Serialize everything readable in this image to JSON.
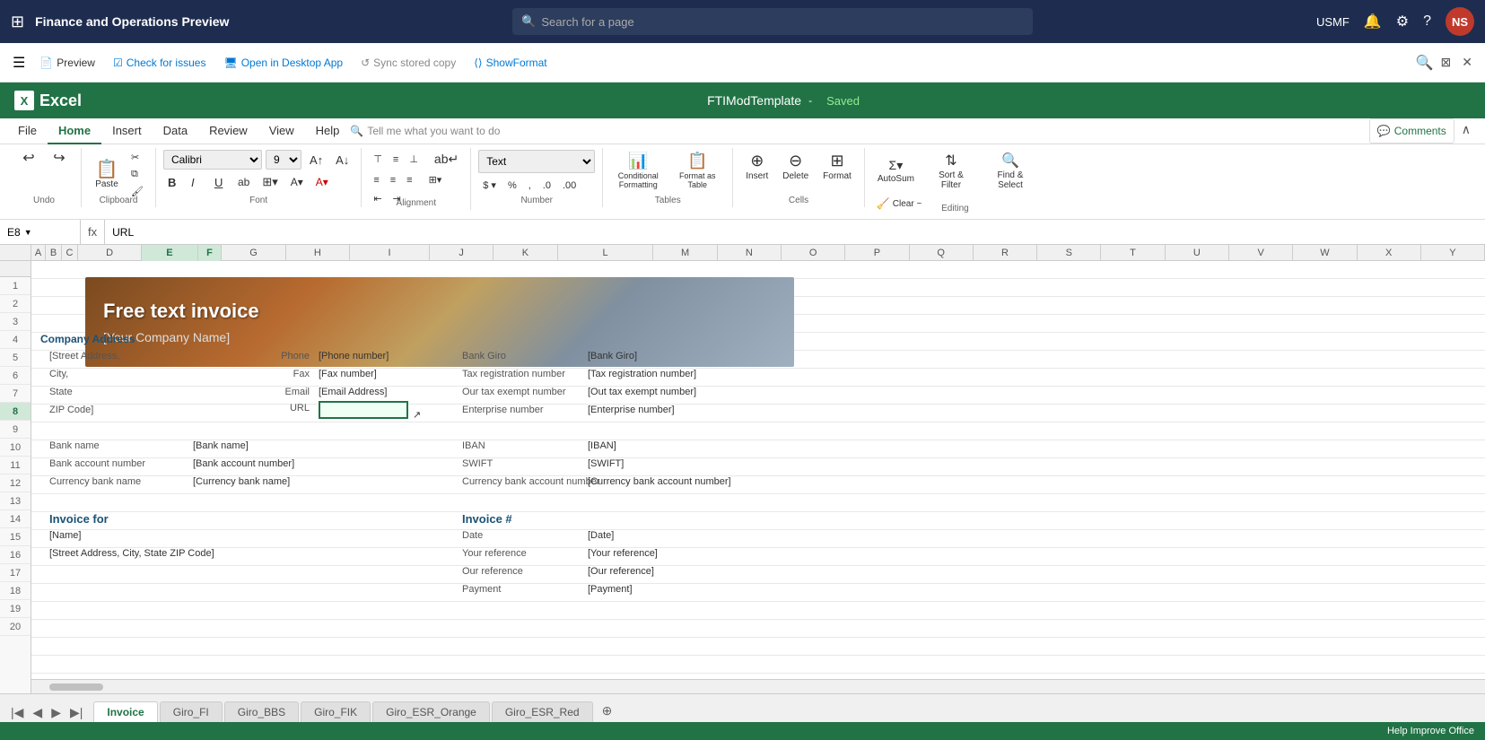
{
  "topNav": {
    "appTitle": "Finance and Operations Preview",
    "searchPlaceholder": "Search for a page",
    "userCode": "USMF",
    "userInitials": "NS"
  },
  "d365Toolbar": {
    "previewLabel": "Preview",
    "checkIssuesLabel": "Check for issues",
    "openDesktopLabel": "Open in Desktop App",
    "syncLabel": "Sync stored copy",
    "showFormatLabel": "ShowFormat"
  },
  "excel": {
    "appName": "Excel",
    "docTitle": "FTIModTemplate",
    "savedLabel": "Saved"
  },
  "ribbon": {
    "tabs": [
      "File",
      "Home",
      "Insert",
      "Data",
      "Review",
      "View",
      "Help"
    ],
    "activeTab": "Home",
    "tellMe": "Tell me what you want to do",
    "commentsLabel": "Comments",
    "groups": {
      "undo": "Undo",
      "clipboard": "Clipboard",
      "font": "Font",
      "alignment": "Alignment",
      "number": "Number",
      "tables": "Tables",
      "cells": "Cells",
      "editing": "Editing"
    },
    "fontName": "Calibri",
    "fontSize": "9",
    "numberFormat": "Text",
    "pasteLabel": "Paste",
    "boldLabel": "B",
    "italicLabel": "I",
    "underlineLabel": "U",
    "autoSumLabel": "AutoSum",
    "sortFilterLabel": "Sort & Filter",
    "findSelectLabel": "Find & Select",
    "conditionalFormattingLabel": "Conditional Formatting",
    "formatAsTableLabel": "Format as Table",
    "insertLabel": "Insert",
    "deleteLabel": "Delete",
    "formatLabel": "Format",
    "clearLabel": "Clear ~"
  },
  "formulaBar": {
    "cellRef": "E8",
    "formula": "URL"
  },
  "columns": {
    "headers": [
      "A",
      "B",
      "C",
      "D",
      "E",
      "F",
      "G",
      "H",
      "I",
      "J",
      "K",
      "L",
      "M",
      "N",
      "O",
      "P",
      "Q",
      "R",
      "S",
      "T",
      "U",
      "V",
      "W",
      "X",
      "Y"
    ],
    "widths": [
      18,
      20,
      20,
      80,
      70,
      30,
      80,
      80,
      100,
      80,
      80,
      120,
      80,
      80,
      80,
      80,
      80,
      80,
      80,
      80,
      80,
      80,
      80,
      80,
      80
    ],
    "active": [
      "E",
      "F"
    ]
  },
  "rows": {
    "numbers": [
      1,
      2,
      3,
      4,
      5,
      6,
      7,
      8,
      9,
      10,
      11,
      12,
      13,
      14,
      15,
      16,
      17,
      18,
      19,
      20
    ]
  },
  "invoice": {
    "bannerTitle": "Free text invoice",
    "companyName": "[Your Company Name]",
    "companyAddress": "Company Address",
    "streetAddress": "[Street Address,",
    "cityLine": "City,",
    "stateLine": "State",
    "zipLine": "ZIP Code]",
    "phoneLabel": "Phone",
    "phoneValue": "[Phone number]",
    "faxLabel": "Fax",
    "faxValue": "[Fax number]",
    "emailLabel": "Email",
    "emailValue": "[Email Address]",
    "urlLabel": "URL",
    "bankGiroLabel": "Bank Giro",
    "bankGiroValue": "[Bank Giro]",
    "taxRegLabel": "Tax registration number",
    "taxRegValue": "[Tax registration number]",
    "outTaxLabel": "Our tax exempt number",
    "outTaxValue": "[Out tax exempt number]",
    "enterpriseLabel": "Enterprise number",
    "enterpriseValue": "[Enterprise number]",
    "bankNameLabel": "Bank name",
    "bankNameValue": "[Bank name]",
    "ibanLabel": "IBAN",
    "ibanValue": "[IBAN]",
    "bankAccountLabel": "Bank account number",
    "bankAccountValue": "[Bank account number]",
    "swiftLabel": "SWIFT",
    "swiftValue": "[SWIFT]",
    "currencyBankLabel": "Currency bank name",
    "currencyBankValue": "[Currency bank name]",
    "currencyAccountLabel": "Currency bank account number",
    "currencyAccountValue": "[Currency bank account number]",
    "invoiceForLabel": "Invoice for",
    "invoiceNumLabel": "Invoice #",
    "nameValue": "[Name]",
    "addressValue": "[Street Address, City, State ZIP Code]",
    "dateLabel": "Date",
    "dateValue": "[Date]",
    "yourRefLabel": "Your reference",
    "yourRefValue": "[Your reference]",
    "ourRefLabel": "Our reference",
    "ourRefValue": "[Our reference]",
    "paymentLabel": "Payment",
    "paymentValue": "[Payment]"
  },
  "sheetTabs": {
    "tabs": [
      "Invoice",
      "Giro_FI",
      "Giro_BBS",
      "Giro_FIK",
      "Giro_ESR_Orange",
      "Giro_ESR_Red"
    ],
    "activeTab": "Invoice"
  },
  "statusBar": {
    "text": "Help Improve Office"
  }
}
